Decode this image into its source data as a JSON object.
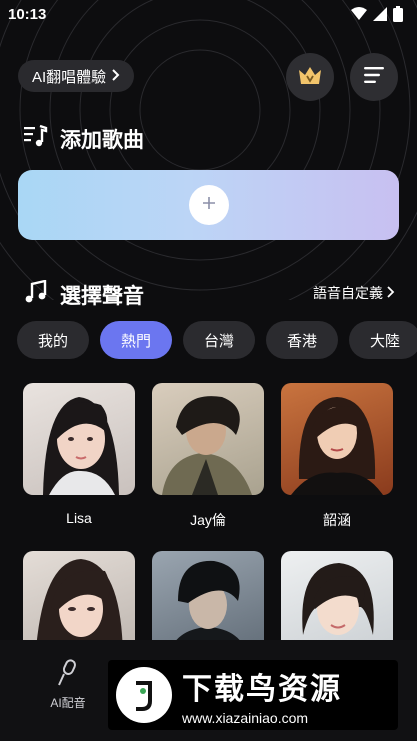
{
  "status": {
    "time": "10:13"
  },
  "header": {
    "ai_pill_label": "AI翻唱體驗",
    "crown_icon": "crown-icon",
    "menu_icon": "menu-icon"
  },
  "add_song": {
    "title": "添加歌曲",
    "add_icon": "plus-icon"
  },
  "voices": {
    "title": "選擇聲音",
    "custom_link": "語音自定義",
    "tabs": [
      {
        "label": "我的",
        "active": false
      },
      {
        "label": "熱門",
        "active": true
      },
      {
        "label": "台灣",
        "active": false
      },
      {
        "label": "香港",
        "active": false
      },
      {
        "label": "大陸",
        "active": false
      }
    ],
    "cards": [
      {
        "name": "Lisa"
      },
      {
        "name": "Jay倫"
      },
      {
        "name": "韶涵"
      },
      {
        "name": ""
      },
      {
        "name": ""
      },
      {
        "name": ""
      }
    ]
  },
  "bottom_nav": {
    "items": [
      {
        "label": "AI配音",
        "icon": "microphone-icon"
      }
    ]
  },
  "watermark": {
    "title": "下载鸟资源",
    "url": "www.xiazainiao.com"
  },
  "colors": {
    "accent": "#6b76f0",
    "background": "#0d0d0f",
    "chip": "#2b2b2f"
  }
}
